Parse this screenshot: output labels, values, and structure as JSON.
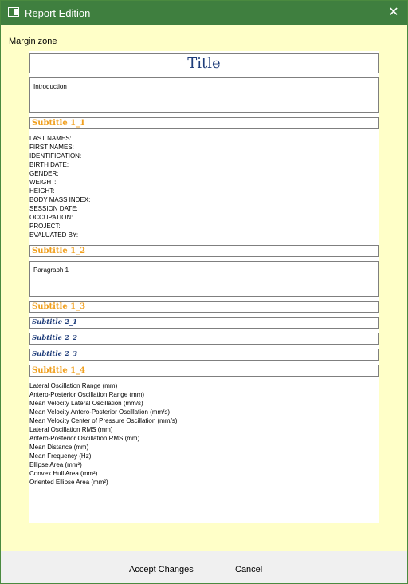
{
  "window": {
    "title": "Report Edition"
  },
  "margin_zone_label": "Margin zone",
  "report": {
    "title": "Title",
    "introduction": "Introduction",
    "subtitle_1_1": "Subtitle 1_1",
    "patient_fields": [
      "LAST NAMES:",
      "FIRST NAMES:",
      "IDENTIFICATION:",
      "BIRTH DATE:",
      "GENDER:",
      "WEIGHT:",
      "HEIGHT:",
      "BODY MASS INDEX:",
      "SESSION DATE:",
      "OCCUPATION:",
      "PROJECT:",
      "EVALUATED BY:"
    ],
    "subtitle_1_2": "Subtitle 1_2",
    "paragraph_1": "Paragraph 1",
    "subtitle_1_3": "Subtitle 1_3",
    "subtitle_2_1": "Subtitle 2_1",
    "subtitle_2_2": "Subtitle 2_2",
    "subtitle_2_3": "Subtitle 2_3",
    "subtitle_1_4": "Subtitle 1_4",
    "metrics": [
      "Lateral Oscillation Range (mm)",
      "Antero-Posterior Oscillation Range (mm)",
      "Mean Velocity Lateral Oscillation (mm/s)",
      "Mean Velocity Antero-Posterior Oscillation (mm/s)",
      "Mean Velocity Center of Pressure Oscillation (mm/s)",
      "Lateral Oscillation RMS (mm)",
      "Antero-Posterior Oscillation RMS (mm)",
      "Mean Distance (mm)",
      "Mean Frequency (Hz)",
      "Ellipse Area (mm²)",
      "Convex Hull Area (mm²)",
      "Oriented Ellipse Area (mm²)"
    ]
  },
  "buttons": {
    "accept": "Accept Changes",
    "cancel": "Cancel"
  },
  "colors": {
    "titlebar": "#3f7f3f",
    "background": "#ffffc8",
    "subtitle1": "#f0a020",
    "subtitle2": "#1f3d7a"
  }
}
